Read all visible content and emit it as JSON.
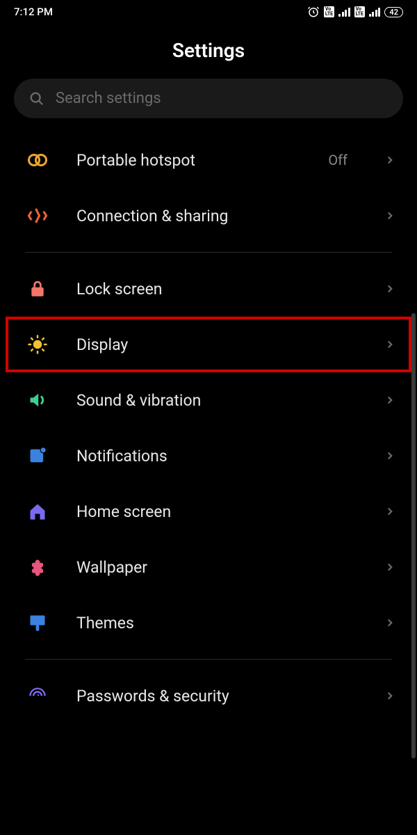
{
  "status": {
    "time": "7:12 PM",
    "battery": "42"
  },
  "header": {
    "title": "Settings",
    "search_placeholder": "Search settings"
  },
  "items": [
    {
      "id": "portable-hotspot",
      "label": "Portable hotspot",
      "value": "Off",
      "icon": "hotspot",
      "color": "#e8a530"
    },
    {
      "id": "connection-sharing",
      "label": "Connection & sharing",
      "value": "",
      "icon": "share",
      "color": "#e8623a"
    },
    {
      "id": "lock-screen",
      "label": "Lock screen",
      "value": "",
      "icon": "lock",
      "color": "#f0766a"
    },
    {
      "id": "display",
      "label": "Display",
      "value": "",
      "icon": "sun",
      "color": "#f0c230",
      "highlighted": true
    },
    {
      "id": "sound-vibration",
      "label": "Sound & vibration",
      "value": "",
      "icon": "speaker",
      "color": "#3dcf8f"
    },
    {
      "id": "notifications",
      "label": "Notifications",
      "value": "",
      "icon": "notification",
      "color": "#3b82e0"
    },
    {
      "id": "home-screen",
      "label": "Home screen",
      "value": "",
      "icon": "home",
      "color": "#7b6af0"
    },
    {
      "id": "wallpaper",
      "label": "Wallpaper",
      "value": "",
      "icon": "flower",
      "color": "#e8557f"
    },
    {
      "id": "themes",
      "label": "Themes",
      "value": "",
      "icon": "brush",
      "color": "#3b82e0"
    },
    {
      "id": "passwords-security",
      "label": "Passwords & security",
      "value": "",
      "icon": "fingerprint",
      "color": "#7b6af0"
    }
  ]
}
